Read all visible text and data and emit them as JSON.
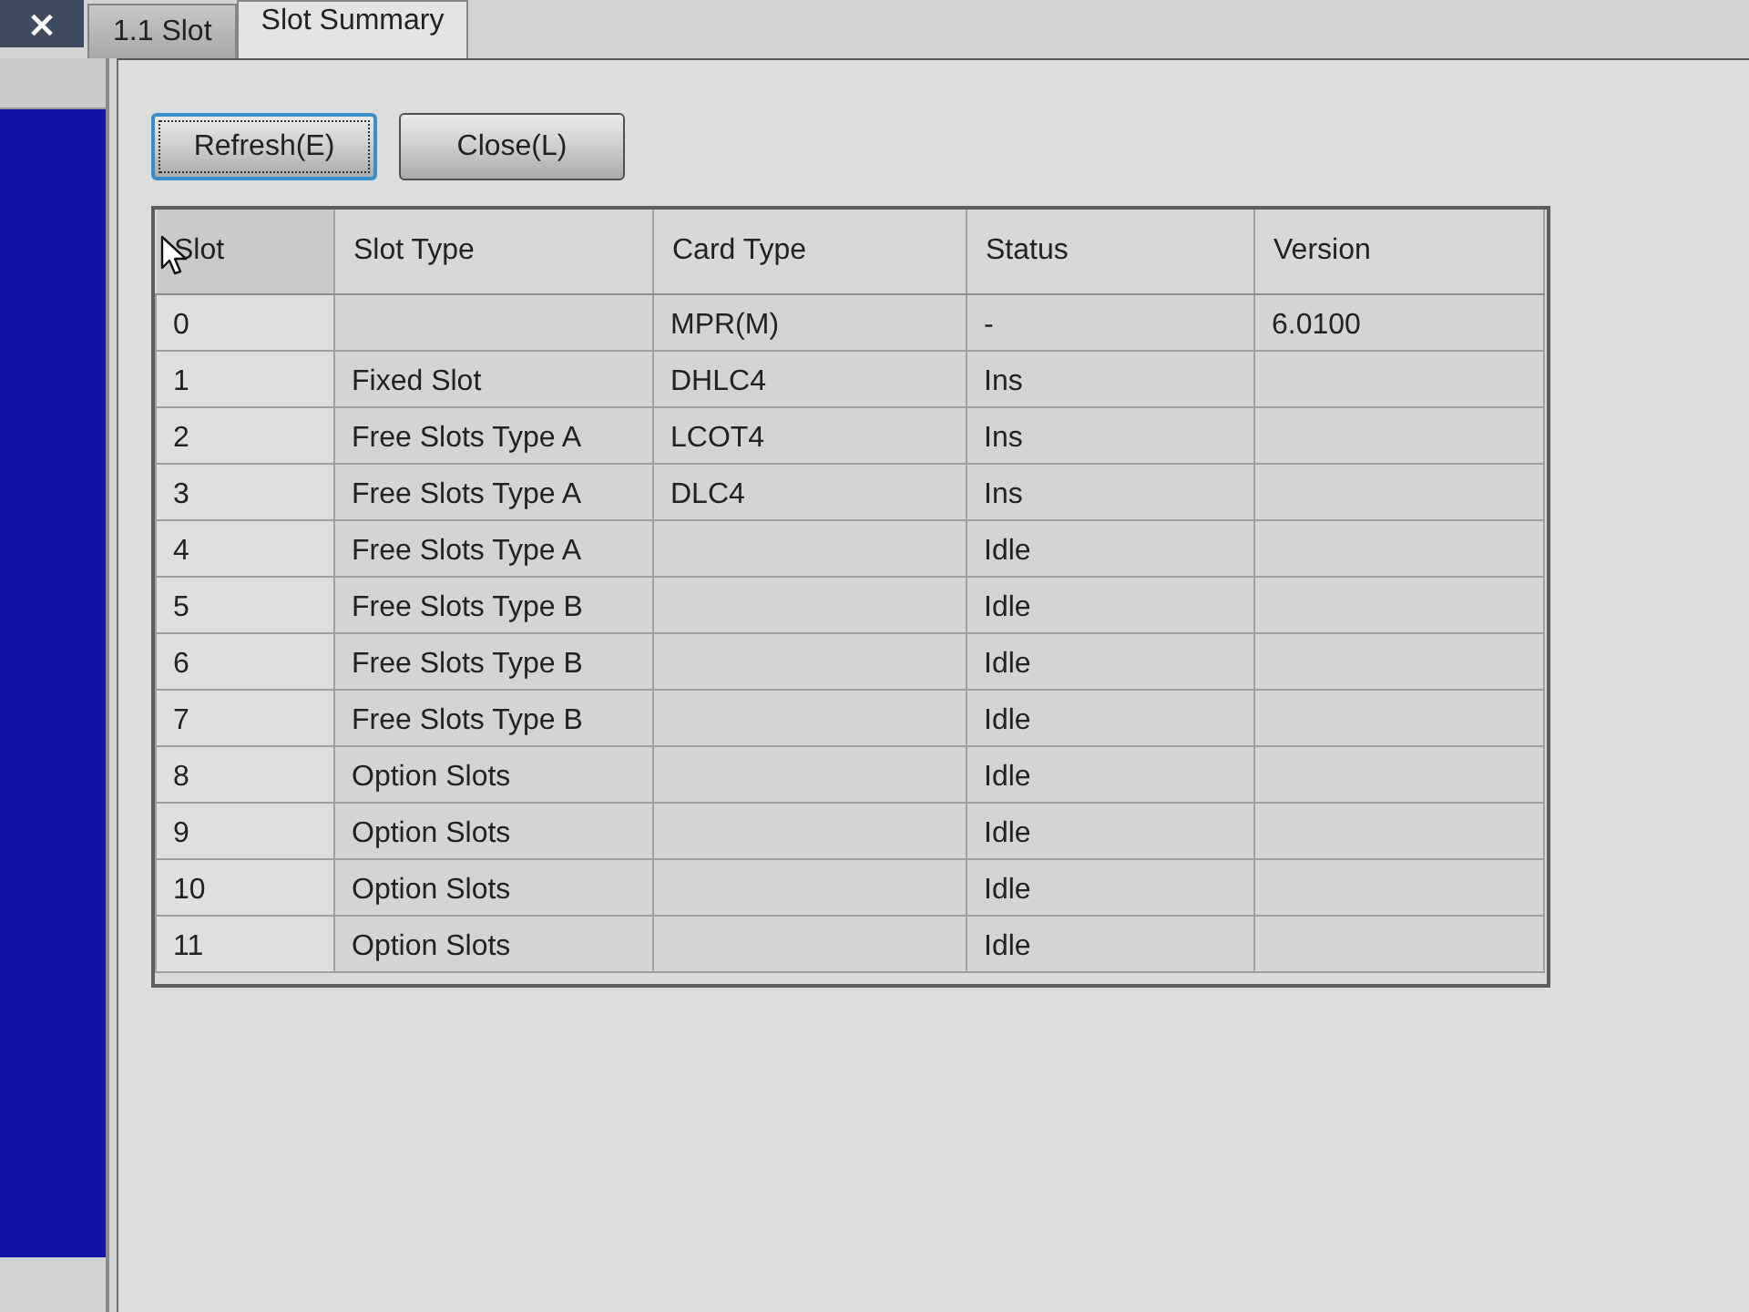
{
  "close_button": {
    "label": "×"
  },
  "tabs": [
    {
      "label": "1.1 Slot",
      "selected": false
    },
    {
      "label": "Slot Summary",
      "selected": true
    }
  ],
  "buttons": [
    {
      "label": "Refresh(E)",
      "focused": true
    },
    {
      "label": "Close(L)",
      "focused": false
    }
  ],
  "table": {
    "columns": [
      "Slot",
      "Slot Type",
      "Card Type",
      "Status",
      "Version"
    ],
    "rows": [
      {
        "slot": "0",
        "card_type": "MPR(M)",
        "status": "-",
        "version": "6.0100"
      },
      {
        "slot": "1",
        "slot_type": "Fixed Slot",
        "card_type": "DHLC4",
        "status": "Ins"
      },
      {
        "slot": "2",
        "slot_type": "Free Slots Type A",
        "card_type": "LCOT4",
        "status": "Ins"
      },
      {
        "slot": "3",
        "slot_type": "Free Slots Type A",
        "card_type": "DLC4",
        "status": "Ins"
      },
      {
        "slot": "4",
        "slot_type": "Free Slots Type A",
        "status": "Idle"
      },
      {
        "slot": "5",
        "slot_type": "Free Slots Type B",
        "status": "Idle"
      },
      {
        "slot": "6",
        "slot_type": "Free Slots Type B",
        "status": "Idle"
      },
      {
        "slot": "7",
        "slot_type": "Free Slots Type B",
        "status": "Idle"
      },
      {
        "slot": "8",
        "slot_type": "Option Slots",
        "status": "Idle"
      },
      {
        "slot": "9",
        "slot_type": "Option Slots",
        "status": "Idle"
      },
      {
        "slot": "10",
        "slot_type": "Option Slots",
        "status": "Idle"
      },
      {
        "slot": "11",
        "slot_type": "Option Slots",
        "status": "Idle"
      }
    ]
  }
}
